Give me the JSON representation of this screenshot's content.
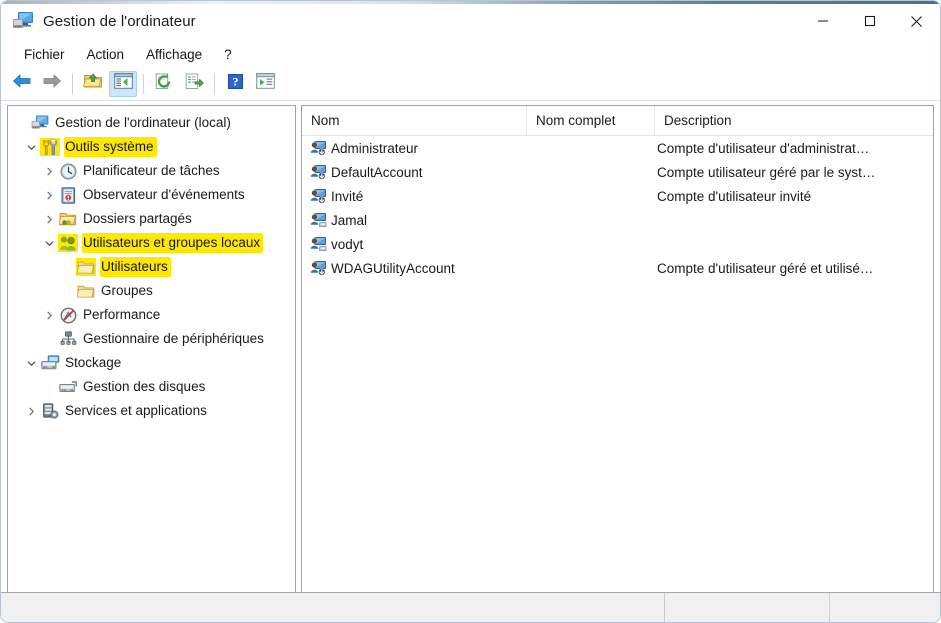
{
  "window": {
    "title": "Gestion de l'ordinateur",
    "app_icon": "computer-management-icon",
    "minimize_label": "Réduire",
    "maximize_label": "Agrandir",
    "close_label": "Fermer"
  },
  "menubar": {
    "items": [
      {
        "label": "Fichier",
        "name": "menu-fichier"
      },
      {
        "label": "Action",
        "name": "menu-action"
      },
      {
        "label": "Affichage",
        "name": "menu-affichage"
      },
      {
        "label": "?",
        "name": "menu-aide"
      }
    ]
  },
  "toolbar": {
    "buttons": [
      {
        "icon": "back-arrow-icon",
        "label": "Précédent",
        "active": false
      },
      {
        "icon": "forward-arrow-icon",
        "label": "Suivant",
        "active": false
      },
      {
        "icon": "up-folder-icon",
        "label": "Monter d'un niveau",
        "active": false
      },
      {
        "icon": "show-console-tree-icon",
        "label": "Afficher/Masquer l'arborescence de la console",
        "active": true
      },
      {
        "icon": "refresh-icon",
        "label": "Actualiser",
        "active": false
      },
      {
        "icon": "export-list-icon",
        "label": "Exporter la liste",
        "active": false
      },
      {
        "icon": "help-icon",
        "label": "Aide",
        "active": false
      },
      {
        "icon": "properties-window-icon",
        "label": "Propriétés",
        "active": false
      }
    ]
  },
  "tree": {
    "nodes": [
      {
        "label": "Gestion de l'ordinateur (local)",
        "icon": "computer-icon",
        "indent": 0,
        "twisty": "none",
        "highlight": false
      },
      {
        "label": "Outils système",
        "icon": "system-tools-icon",
        "indent": 1,
        "twisty": "expanded",
        "highlight": true
      },
      {
        "label": "Planificateur de tâches",
        "icon": "task-scheduler-clock-icon",
        "indent": 2,
        "twisty": "collapsed",
        "highlight": false
      },
      {
        "label": "Observateur d'événements",
        "icon": "event-viewer-icon",
        "indent": 2,
        "twisty": "collapsed",
        "highlight": false
      },
      {
        "label": "Dossiers partagés",
        "icon": "shared-folders-icon",
        "indent": 2,
        "twisty": "collapsed",
        "highlight": false
      },
      {
        "label": "Utilisateurs et groupes locaux",
        "icon": "local-users-groups-icon",
        "indent": 2,
        "twisty": "expanded",
        "highlight": true
      },
      {
        "label": "Utilisateurs",
        "icon": "folder-icon",
        "indent": 3,
        "twisty": "none",
        "highlight": true
      },
      {
        "label": "Groupes",
        "icon": "folder-icon",
        "indent": 3,
        "twisty": "none",
        "highlight": false
      },
      {
        "label": "Performance",
        "icon": "performance-icon",
        "indent": 2,
        "twisty": "collapsed",
        "highlight": false
      },
      {
        "label": "Gestionnaire de périphériques",
        "icon": "device-manager-icon",
        "indent": 2,
        "twisty": "none",
        "highlight": false
      },
      {
        "label": "Stockage",
        "icon": "storage-icon",
        "indent": 1,
        "twisty": "expanded",
        "highlight": false
      },
      {
        "label": "Gestion des disques",
        "icon": "disk-management-icon",
        "indent": 2,
        "twisty": "none",
        "highlight": false
      },
      {
        "label": "Services et applications",
        "icon": "services-applications-icon",
        "indent": 1,
        "twisty": "collapsed",
        "highlight": false
      }
    ]
  },
  "list": {
    "columns": [
      {
        "label": "Nom",
        "name": "column-header-nom"
      },
      {
        "label": "Nom complet",
        "name": "column-header-nom-complet"
      },
      {
        "label": "Description",
        "name": "column-header-description"
      }
    ],
    "rows": [
      {
        "name": "Administrateur",
        "full_name": "",
        "description": "Compte d'utilisateur d'administrat…",
        "icon": "user-disabled-icon"
      },
      {
        "name": "DefaultAccount",
        "full_name": "",
        "description": "Compte utilisateur géré par le syst…",
        "icon": "user-disabled-icon"
      },
      {
        "name": "Invité",
        "full_name": "",
        "description": "Compte d'utilisateur invité",
        "icon": "user-disabled-icon"
      },
      {
        "name": "Jamal",
        "full_name": "",
        "description": "",
        "icon": "user-icon"
      },
      {
        "name": "vodyt",
        "full_name": "",
        "description": "",
        "icon": "user-icon"
      },
      {
        "name": "WDAGUtilityAccount",
        "full_name": "",
        "description": "Compte d'utilisateur géré et utilisé…",
        "icon": "user-disabled-icon"
      }
    ]
  },
  "statusbar": {
    "panes": [
      "",
      "",
      ""
    ]
  },
  "colors": {
    "highlight_yellow": "#ffe800",
    "toolbar_active": "#cde6f7",
    "pane_border": "#9aa3ab",
    "text": "#1a1a1a"
  }
}
